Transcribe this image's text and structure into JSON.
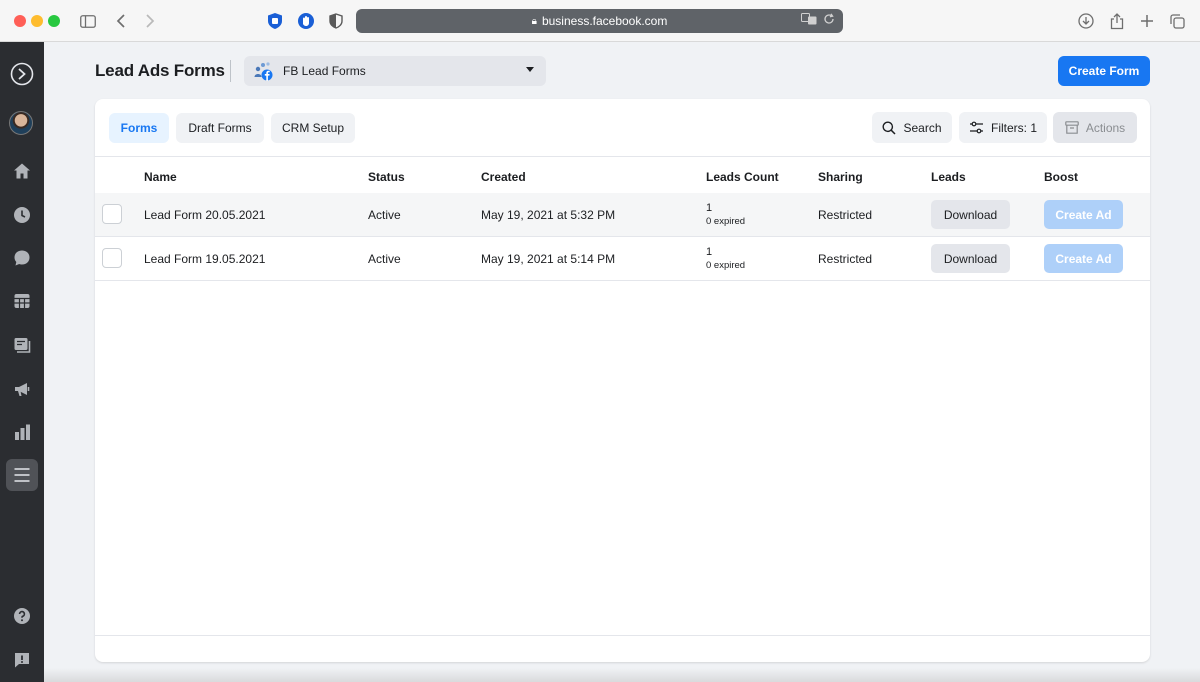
{
  "browser": {
    "url": "business.facebook.com"
  },
  "header": {
    "title": "Lead Ads Forms",
    "account": "FB Lead Forms",
    "create_button": "Create Form"
  },
  "tabs": [
    {
      "label": "Forms",
      "active": true
    },
    {
      "label": "Draft Forms",
      "active": false
    },
    {
      "label": "CRM Setup",
      "active": false
    }
  ],
  "toolbar": {
    "search": "Search",
    "filters": "Filters: 1",
    "actions": "Actions"
  },
  "table": {
    "columns": [
      "Name",
      "Status",
      "Created",
      "Leads Count",
      "Sharing",
      "Leads",
      "Boost"
    ],
    "rows": [
      {
        "name": "Lead Form 20.05.2021",
        "status": "Active",
        "created": "May 19, 2021 at 5:32 PM",
        "leads_count": "1",
        "expired": "0 expired",
        "sharing": "Restricted",
        "leads_action": "Download",
        "boost_action": "Create Ad"
      },
      {
        "name": "Lead Form 19.05.2021",
        "status": "Active",
        "created": "May 19, 2021 at 5:14 PM",
        "leads_count": "1",
        "expired": "0 expired",
        "sharing": "Restricted",
        "leads_action": "Download",
        "boost_action": "Create Ad"
      }
    ]
  },
  "colors": {
    "brand_blue": "#1877f2",
    "disabled_blue": "#aed0f9",
    "rail_bg": "#2b2d31"
  },
  "icons": {
    "rail": [
      "meta-logo-icon",
      "avatar",
      "home-icon",
      "clock-icon",
      "chat-icon",
      "grid-icon",
      "pages-icon",
      "megaphone-icon",
      "bar-chart-icon",
      "menu-icon",
      "help-icon",
      "feedback-icon"
    ]
  }
}
